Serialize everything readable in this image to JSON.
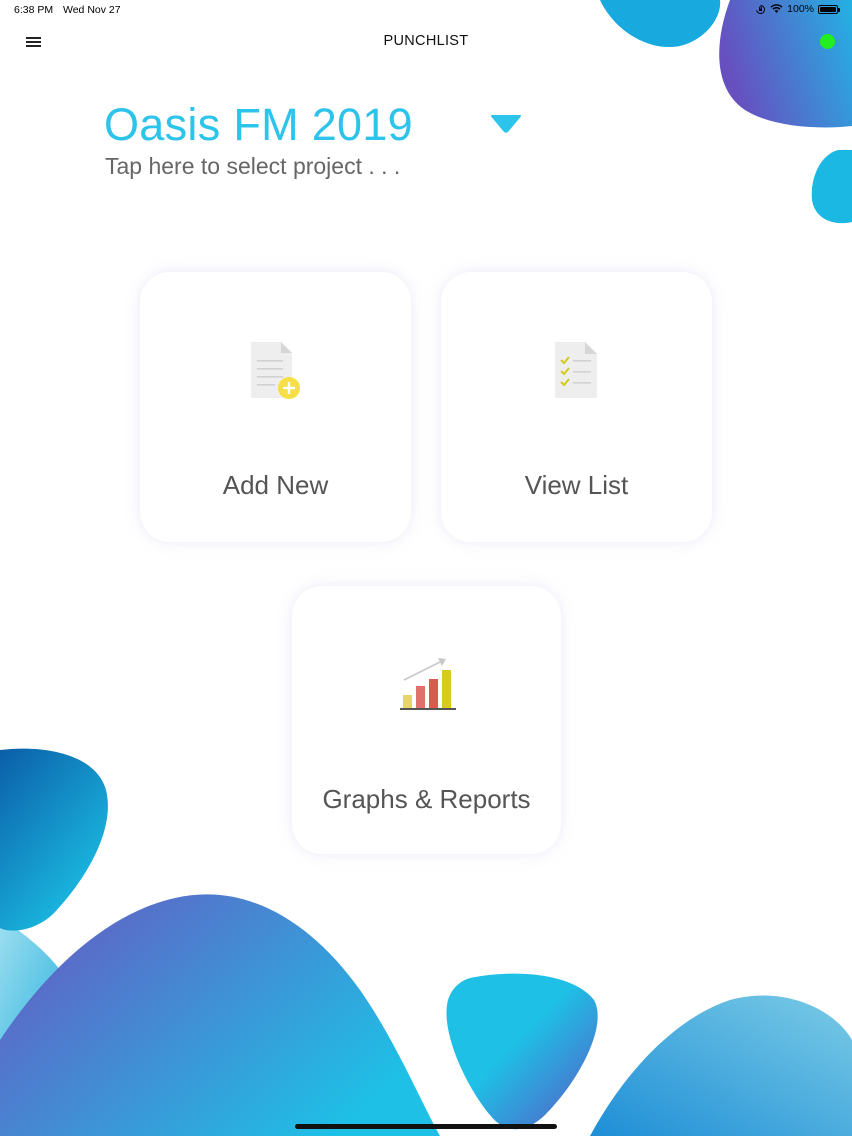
{
  "status_bar": {
    "time": "6:38 PM",
    "date": "Wed Nov 27",
    "battery": "100%",
    "icons": [
      "orientation-lock-icon",
      "wifi-icon",
      "battery-icon"
    ]
  },
  "nav": {
    "title": "PUNCHLIST",
    "menu_icon": "hamburger-menu-icon",
    "status_dot_color": "#22ee22"
  },
  "project": {
    "name": "Oasis FM 2019",
    "hint": "Tap here to select project . . .",
    "dropdown_icon": "triangle-down-icon"
  },
  "tiles": [
    {
      "label": "Add New",
      "icon": "add-document-icon"
    },
    {
      "label": "View List",
      "icon": "checklist-document-icon"
    },
    {
      "label": "Graphs & Reports",
      "icon": "bar-chart-icon"
    }
  ],
  "colors": {
    "accent": "#2cc4ea",
    "blob_purple": "#6a55c0",
    "blob_cyan": "#1ec0e6",
    "blob_blue": "#0b6ab0"
  }
}
